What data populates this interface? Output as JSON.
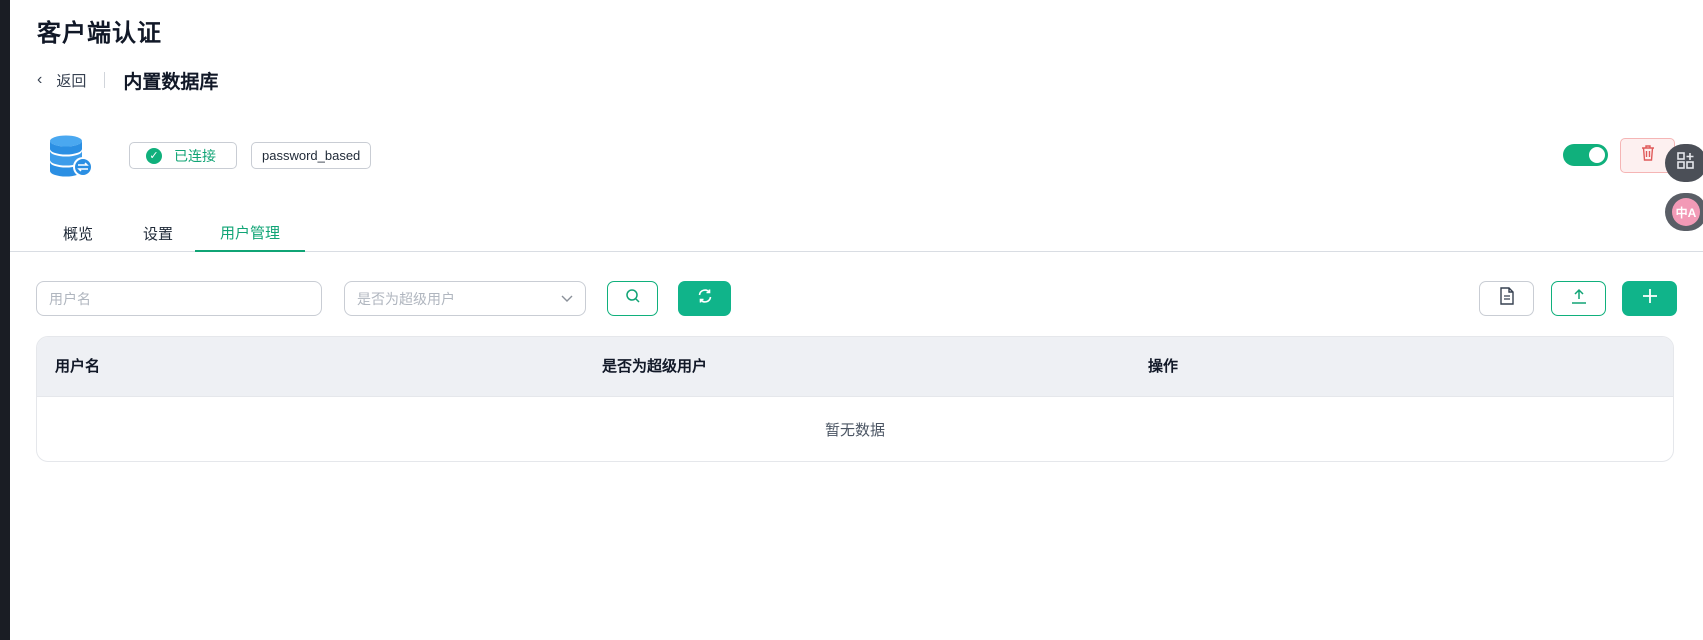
{
  "page": {
    "title": "客户端认证"
  },
  "breadcrumb": {
    "back_label": "返回",
    "current": "内置数据库"
  },
  "database": {
    "status_label": "已连接",
    "type_label": "password_based",
    "enabled": true
  },
  "tabs": [
    {
      "label": "概览",
      "active": false
    },
    {
      "label": "设置",
      "active": false
    },
    {
      "label": "用户管理",
      "active": true
    }
  ],
  "filters": {
    "username_placeholder": "用户名",
    "superuser_placeholder": "是否为超级用户"
  },
  "table": {
    "columns": [
      "用户名",
      "是否为超级用户",
      "操作"
    ],
    "rows": [],
    "empty_text": "暂无数据"
  },
  "colors": {
    "accent": "#10b07c",
    "danger": "#e05a5a",
    "header_bg": "#eef0f4"
  },
  "icons": {
    "database": "database-icon",
    "check": "check-circle-icon",
    "trash": "trash-icon",
    "search": "search-icon",
    "refresh": "refresh-icon",
    "document": "document-icon",
    "upload": "upload-icon",
    "add": "plus-icon"
  }
}
